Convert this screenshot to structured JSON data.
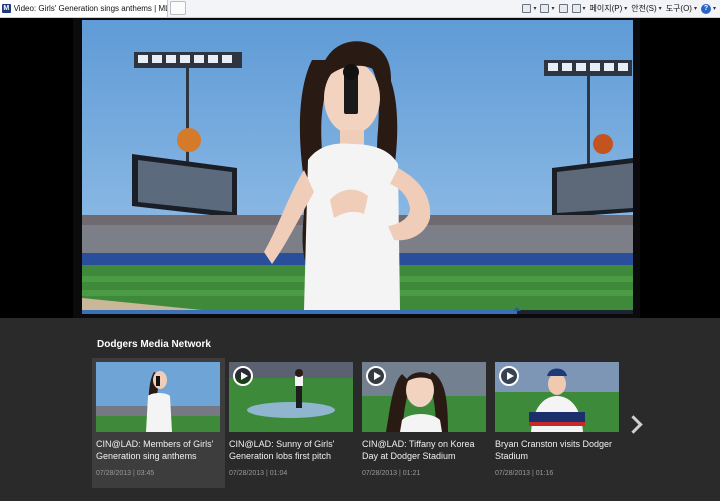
{
  "browser": {
    "tab_title": "Video: Girls' Generation sings anthems | MLB.co...",
    "favicon_text": "M",
    "commands": [
      {
        "label": "",
        "icon": "home-icon"
      },
      {
        "label": "",
        "icon": "feeds-icon"
      },
      {
        "label": "",
        "icon": "mail-icon"
      },
      {
        "label": "",
        "icon": "print-icon"
      },
      {
        "label": "페이지(P)",
        "icon": "page-icon"
      },
      {
        "label": "안전(S)",
        "icon": "safety-icon"
      },
      {
        "label": "도구(O)",
        "icon": "tools-icon"
      }
    ],
    "help_symbol": "?"
  },
  "player": {
    "progress_fraction": 0.79,
    "colors": {
      "sky": "#6aa3d8",
      "field": "#3f8a3a",
      "accent": "#3a70b6"
    }
  },
  "media": {
    "section_title": "Dodgers Media Network",
    "cards": [
      {
        "title": "CIN@LAD: Members of Girls' Generation sing anthems",
        "date": "07/28/2013",
        "duration": "03:45",
        "meta": "07/28/2013 | 03:45",
        "active": true
      },
      {
        "title": "CIN@LAD: Sunny of Girls' Generation lobs first pitch",
        "date": "07/28/2013",
        "duration": "01:04",
        "meta": "07/28/2013 | 01:04",
        "active": false
      },
      {
        "title": "CIN@LAD: Tiffany on Korea Day at Dodger Stadium",
        "date": "07/28/2013",
        "duration": "01:21",
        "meta": "07/28/2013 | 01:21",
        "active": false
      },
      {
        "title": "Bryan Cranston visits Dodger Stadium",
        "date": "07/28/2013",
        "duration": "01:16",
        "meta": "07/28/2013 | 01:16",
        "active": false
      }
    ]
  }
}
